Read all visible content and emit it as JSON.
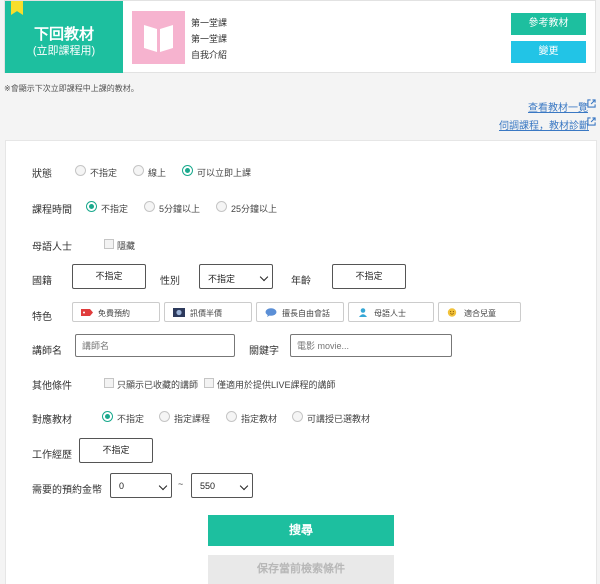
{
  "material": {
    "heading": "下回教材",
    "subheading": "(立即課程用)",
    "lines": [
      "第一堂課",
      "第一堂課",
      "自我介紹"
    ],
    "reference_button": "參考教材",
    "change_button": "變更"
  },
  "notice": "※會顯示下次立即課程中上課的教材。",
  "links": {
    "material_list": "查看教材一覽",
    "diagnosis": "伺調課程，教材診斷"
  },
  "filters": {
    "status": {
      "label": "狀態",
      "options": [
        "不指定",
        "線上",
        "可以立即上課"
      ],
      "selected": 2
    },
    "lesson_time": {
      "label": "課程時間",
      "options": [
        "不指定",
        "5分鐘以上",
        "25分鐘以上"
      ],
      "selected": 0
    },
    "native": {
      "label": "母語人士",
      "checkbox": "隱藏"
    },
    "nationality": {
      "label": "國籍",
      "value": "不指定"
    },
    "gender": {
      "label": "性別",
      "value": "不指定"
    },
    "age": {
      "label": "年齡",
      "value": "不指定"
    },
    "features": {
      "label": "特色",
      "items": [
        "免費預約",
        "訊價半價",
        "擅長自由會話",
        "母語人士",
        "適合兒童"
      ]
    },
    "teacher_name": {
      "label": "講師名",
      "placeholder": "講師名"
    },
    "keyword": {
      "label": "關鍵字",
      "placeholder": "電影 movie..."
    },
    "other": {
      "label": "其他條件",
      "checks": [
        "只顯示已收藏的講師",
        "僅適用於提供LIVE課程的講師"
      ]
    },
    "material": {
      "label": "對應教材",
      "options": [
        "不指定",
        "指定課程",
        "指定教材",
        "可講授已選教材"
      ],
      "selected": 0
    },
    "experience": {
      "label": "工作經歷",
      "value": "不指定"
    },
    "price": {
      "label": "需要的預約金幣",
      "min": "0",
      "separator": "~",
      "max": "550"
    }
  },
  "actions": {
    "search": "搜尋",
    "save": "保存當前檢索條件"
  },
  "colors": {
    "accent": "#1dbf9f",
    "cyan_button": "#22c4e6",
    "link": "#3a78c3"
  }
}
